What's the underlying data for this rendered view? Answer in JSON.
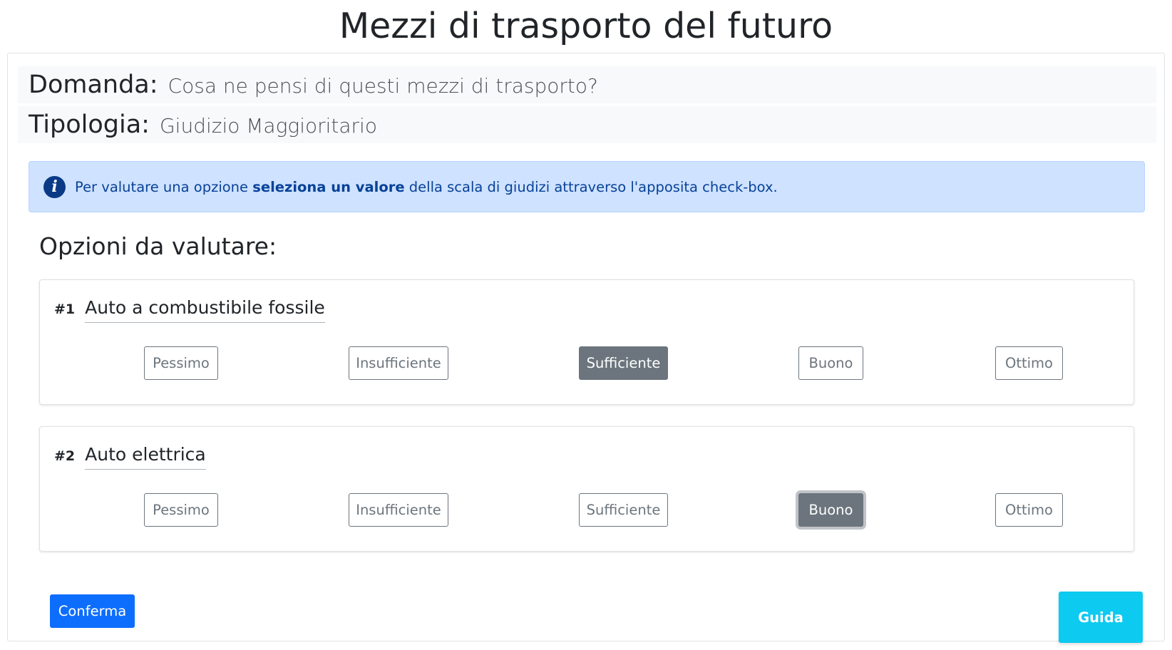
{
  "page": {
    "title": "Mezzi di trasporto del futuro"
  },
  "question": {
    "label": "Domanda:",
    "value": "Cosa ne pensi di questi mezzi di trasporto?"
  },
  "type": {
    "label": "Tipologia:",
    "value": "Giudizio Maggioritario"
  },
  "alert": {
    "icon": "info-icon",
    "text_before": "Per valutare una opzione ",
    "text_bold": "seleziona un valore",
    "text_after": " della scala di giudizi attraverso l'apposita check-box."
  },
  "options_section": {
    "title": "Opzioni da valutare:"
  },
  "options": [
    {
      "number": "#1",
      "name": "Auto a combustibile fossile",
      "ratings": [
        "Pessimo",
        "Insufficiente",
        "Sufficiente",
        "Buono",
        "Ottimo"
      ],
      "selected": "Sufficiente"
    },
    {
      "number": "#2",
      "name": "Auto elettrica",
      "ratings": [
        "Pessimo",
        "Insufficiente",
        "Sufficiente",
        "Buono",
        "Ottimo"
      ],
      "selected": "Buono"
    }
  ],
  "actions": {
    "confirm_label": "Conferma",
    "guide_label": "Guida"
  },
  "colors": {
    "primary": "#0d6efd",
    "info": "#0dcaf0",
    "secondary": "#6c757d",
    "alert_bg": "#cfe2ff",
    "alert_text": "#084298"
  }
}
